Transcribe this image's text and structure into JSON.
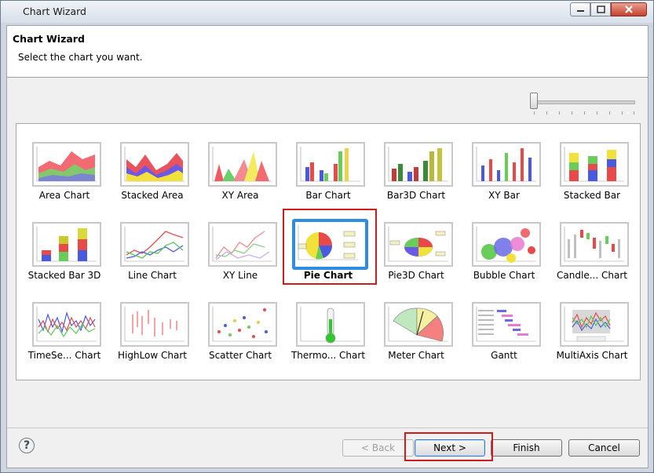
{
  "window": {
    "title": "Chart Wizard"
  },
  "header": {
    "title": "Chart Wizard",
    "subtitle": "Select the chart you want."
  },
  "gallery": {
    "items": [
      {
        "label": "Area Chart",
        "icon": "area-chart-icon"
      },
      {
        "label": "Stacked Area",
        "icon": "stacked-area-icon"
      },
      {
        "label": "XY Area",
        "icon": "xy-area-icon"
      },
      {
        "label": "Bar Chart",
        "icon": "bar-chart-icon"
      },
      {
        "label": "Bar3D Chart",
        "icon": "bar3d-chart-icon"
      },
      {
        "label": "XY Bar",
        "icon": "xy-bar-icon"
      },
      {
        "label": "Stacked Bar",
        "icon": "stacked-bar-icon"
      },
      {
        "label": "Stacked Bar 3D",
        "icon": "stacked-bar-3d-icon"
      },
      {
        "label": "Line Chart",
        "icon": "line-chart-icon"
      },
      {
        "label": "XY Line",
        "icon": "xy-line-icon"
      },
      {
        "label": "Pie Chart",
        "icon": "pie-chart-icon",
        "selected": true
      },
      {
        "label": "Pie3D Chart",
        "icon": "pie3d-chart-icon"
      },
      {
        "label": "Bubble Chart",
        "icon": "bubble-chart-icon"
      },
      {
        "label": "Candle... Chart",
        "icon": "candlestick-chart-icon"
      },
      {
        "label": "TimeSe... Chart",
        "icon": "time-series-chart-icon"
      },
      {
        "label": "HighLow Chart",
        "icon": "high-low-chart-icon"
      },
      {
        "label": "Scatter Chart",
        "icon": "scatter-chart-icon"
      },
      {
        "label": "Thermo... Chart",
        "icon": "thermometer-chart-icon"
      },
      {
        "label": "Meter Chart",
        "icon": "meter-chart-icon"
      },
      {
        "label": "Gantt",
        "icon": "gantt-chart-icon"
      },
      {
        "label": "MultiAxis Chart",
        "icon": "multi-axis-chart-icon"
      }
    ]
  },
  "buttons": {
    "back": "< Back",
    "next": "Next >",
    "finish": "Finish",
    "cancel": "Cancel"
  },
  "help": {
    "glyph": "?"
  },
  "colors": {
    "selection_border": "#2f8de0",
    "highlight_box": "#d01c1c"
  }
}
